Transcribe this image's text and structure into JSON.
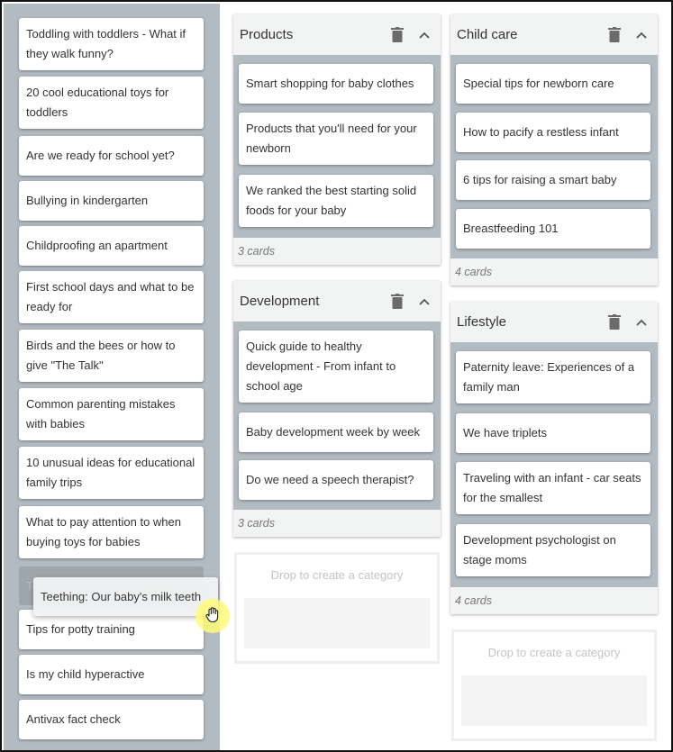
{
  "backlog": {
    "cards": [
      "Toddling with toddlers - What if they walk funny?",
      "20 cool educational toys for toddlers",
      "Are we ready for school yet?",
      "Bullying in kindergarten",
      "Childproofing an apartment",
      "First school days and what to be ready for",
      "Birds and the bees or how to give \"The Talk\"",
      "Common parenting mistakes with babies",
      "10 unusual ideas for educational family trips",
      "What to pay attention to when buying toys for babies",
      "Tips for potty training",
      "Is my child hyperactive",
      "Antivax fact check"
    ],
    "placeholder_text": "Teething: Our baby's milk teeth",
    "dragging_card": "Teething: Our baby's milk teeth"
  },
  "categories": [
    {
      "title": "Products",
      "cards": [
        "Smart shopping for baby clothes",
        "Products that you'll need for your newborn",
        "We ranked the best starting solid foods for your baby"
      ],
      "count": "3 cards"
    },
    {
      "title": "Development",
      "cards": [
        "Quick guide to healthy development - From infant to school age",
        "Baby development week by week",
        "Do we need a speech therapist?"
      ],
      "count": "3 cards"
    },
    {
      "title": "Child care",
      "cards": [
        "Special tips for newborn care",
        "How to pacify a restless infant",
        "6 tips for raising a smart baby",
        "Breastfeeding 101"
      ],
      "count": "4 cards"
    },
    {
      "title": "Lifestyle",
      "cards": [
        "Paternity leave: Experiences of a family man",
        "We have triplets",
        "Traveling with an infant - car seats for the smallest",
        "Development psychologist on stage moms"
      ],
      "count": "4 cards"
    }
  ],
  "drop_zones": [
    {
      "label": "Drop to create a category"
    },
    {
      "label": "Drop to create a category"
    }
  ],
  "icons": {
    "delete": "trash-icon",
    "collapse": "chevron-up-icon",
    "cursor": "grab-hand-icon"
  },
  "colors": {
    "backlog_bg": "#b3bbc2",
    "header_bg": "#f2f3f3",
    "icon": "#6b6b6b",
    "cursor_highlight": "#fffa78"
  }
}
